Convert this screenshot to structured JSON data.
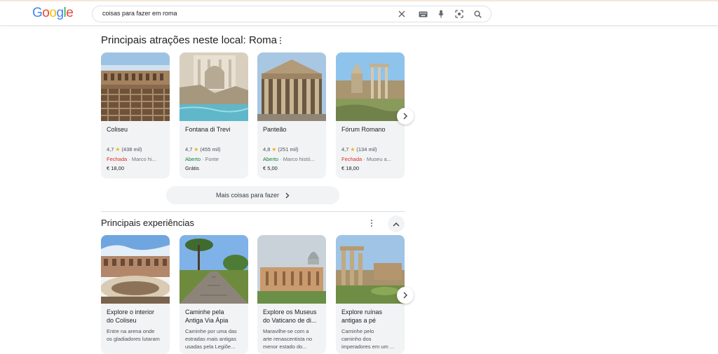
{
  "logo": {
    "letters": [
      "G",
      "o",
      "o",
      "g",
      "l",
      "e"
    ],
    "colors": [
      "#4285f4",
      "#ea4335",
      "#fbbc05",
      "#4285f4",
      "#34a853",
      "#ea4335"
    ]
  },
  "search": {
    "query": "coisas para fazer em roma"
  },
  "icons": {
    "clear": "close-icon",
    "keyboard": "keyboard-icon",
    "mic": "microphone-icon",
    "lens": "lens-icon",
    "search": "search-icon"
  },
  "attractions": {
    "title": "Principais atrações neste local: Roma",
    "cards": [
      {
        "name": "Coliseu",
        "rating": "4,7",
        "reviews": "(438 mil)",
        "status": "Fechada",
        "status_color": "#d93025",
        "category": "Marco hi...",
        "price": "€ 18,00"
      },
      {
        "name": "Fontana di Trevi",
        "rating": "4,7",
        "reviews": "(455 mil)",
        "status": "Aberto",
        "status_color": "#188038",
        "category": "Fonte",
        "price": "Grátis"
      },
      {
        "name": "Panteão",
        "rating": "4,8",
        "reviews": "(251 mil)",
        "status": "Aberto",
        "status_color": "#188038",
        "category": "Marco histó...",
        "price": "€ 5,00"
      },
      {
        "name": "Fórum Romano",
        "rating": "4,7",
        "reviews": "(134 mil)",
        "status": "Fechada",
        "status_color": "#d93025",
        "category": "Museu a...",
        "price": "€ 18,00"
      }
    ],
    "more_label": "Mais coisas para fazer"
  },
  "experiences": {
    "title": "Principais experiências",
    "cards": [
      {
        "title1": "Explore o interior",
        "title2": "do Coliseu",
        "desc1": "Entre na arena onde",
        "desc2": "os gladiadores lutaram"
      },
      {
        "title1": "Caminhe pela",
        "title2": "Antiga Via Ápia",
        "desc1": "Caminhe por uma das",
        "desc2": "estradas mais antigas",
        "desc3": "usadas pela Legiõe..."
      },
      {
        "title1": "Explore os Museus",
        "title2": "do Vaticano de di...",
        "desc1": "Maravilhe-se com a",
        "desc2": "arte renascentista no",
        "desc3": "menor estado do..."
      },
      {
        "title1": "Explore ruínas",
        "title2": "antigas a pé",
        "desc1": "Caminhe pelo",
        "desc2": "caminho dos",
        "desc3": "imperadores em um ..."
      }
    ]
  }
}
